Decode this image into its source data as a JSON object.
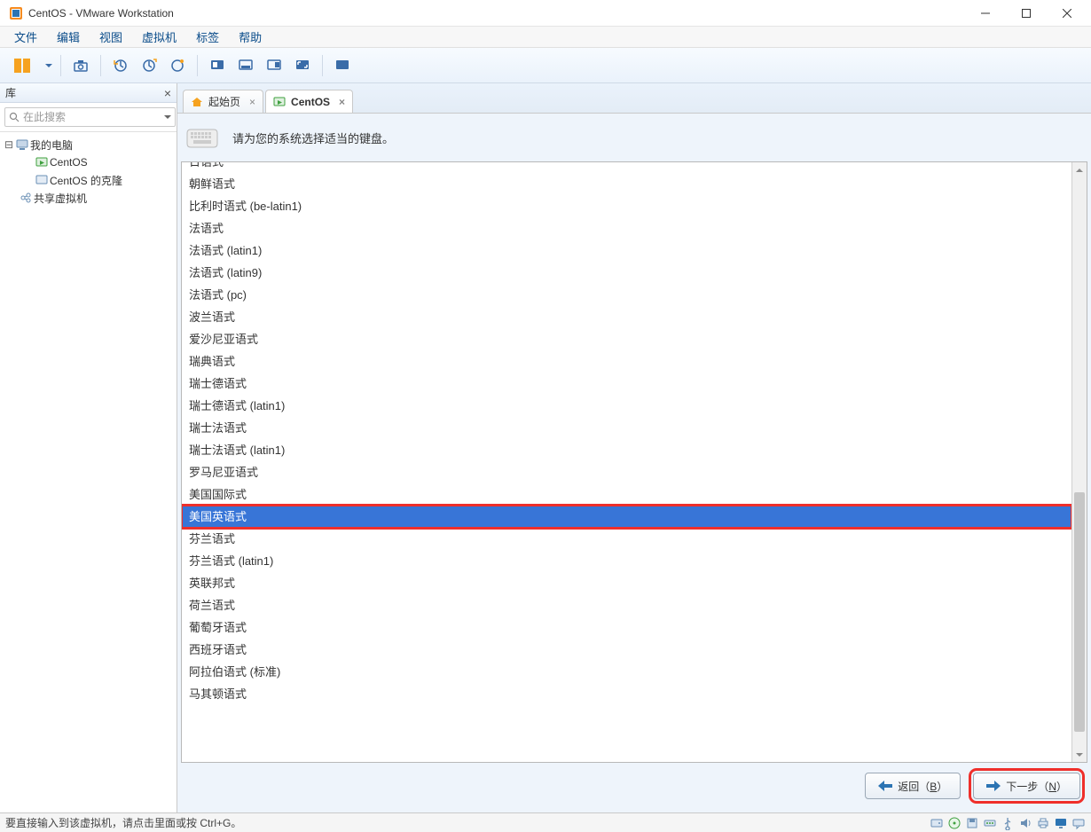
{
  "window": {
    "title": "CentOS - VMware Workstation"
  },
  "menu": {
    "items": [
      "文件",
      "编辑",
      "视图",
      "虚拟机",
      "标签",
      "帮助"
    ]
  },
  "sidebar": {
    "title": "库",
    "search_placeholder": "在此搜索",
    "tree": {
      "root": "我的电脑",
      "centos": "CentOS",
      "centos_clone": "CentOS 的克隆",
      "shared": "共享虚拟机"
    }
  },
  "tabs": {
    "home": "起始页",
    "centos": "CentOS"
  },
  "installer": {
    "prompt": "请为您的系统选择适当的键盘。",
    "selected_index": 15,
    "items": [
      "日语式",
      "朝鲜语式",
      "比利时语式 (be-latin1)",
      "法语式",
      "法语式 (latin1)",
      "法语式 (latin9)",
      "法语式 (pc)",
      "波兰语式",
      "爱沙尼亚语式",
      "瑞典语式",
      "瑞士德语式",
      "瑞士德语式 (latin1)",
      "瑞士法语式",
      "瑞士法语式 (latin1)",
      "罗马尼亚语式",
      "美国国际式",
      "美国英语式",
      "芬兰语式",
      "芬兰语式 (latin1)",
      "英联邦式",
      "荷兰语式",
      "葡萄牙语式",
      "西班牙语式",
      "阿拉伯语式 (标准)",
      "马其顿语式"
    ],
    "back_label": "返回（",
    "back_key": "B",
    "back_suffix": "）",
    "next_label": "下一步（",
    "next_key": "N",
    "next_suffix": "）"
  },
  "statusbar": {
    "text": "要直接输入到该虚拟机，请点击里面或按 Ctrl+G。"
  }
}
